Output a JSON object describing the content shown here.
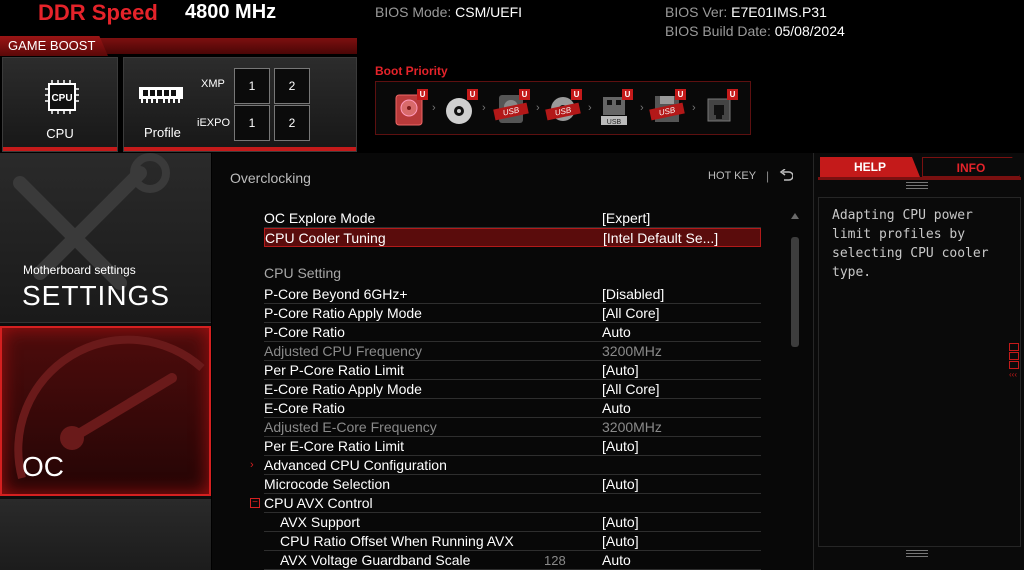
{
  "header": {
    "ddr_label": "DDR Speed",
    "ddr_value": "4800 MHz",
    "game_boost": "GAME BOOST",
    "cpu_tile_label": "CPU",
    "cpu_chip_text": "CPU",
    "profile_tile_label": "Profile",
    "xmp_label": "XMP",
    "iexpo_label": "iEXPO",
    "xmp_buttons": [
      "1",
      "2"
    ],
    "iexpo_buttons": [
      "1",
      "2"
    ],
    "bios_mode_label": "BIOS Mode: ",
    "bios_mode_value": "CSM/UEFI",
    "bios_ver_label": "BIOS Ver: ",
    "bios_ver_value": "E7E01IMS.P31",
    "bios_date_label": "BIOS Build Date: ",
    "bios_date_value": "05/08/2024",
    "boot_priority_label": "Boot Priority",
    "boot_devices": [
      {
        "icon": "hard-drive-icon",
        "badge": "U",
        "text": ""
      },
      {
        "icon": "optical-disc-icon",
        "badge": "U",
        "text": ""
      },
      {
        "icon": "usb-hdd-icon",
        "badge": "U",
        "text": "USB"
      },
      {
        "icon": "usb-cd-icon",
        "badge": "U",
        "text": "USB"
      },
      {
        "icon": "usb-key-icon",
        "badge": "U",
        "text": "USB"
      },
      {
        "icon": "usb-floppy-icon",
        "badge": "U",
        "text": "USB"
      },
      {
        "icon": "network-icon",
        "badge": "U",
        "text": ""
      }
    ]
  },
  "sidebar": {
    "settings_sub": "Motherboard settings",
    "settings_title": "SETTINGS",
    "oc_title": "OC"
  },
  "main": {
    "title": "Overclocking",
    "hotkey": "HOT KEY",
    "hotkey_sep": "|",
    "rows": [
      {
        "label": "OC Explore Mode",
        "value": "[Expert]"
      },
      {
        "label": "CPU Cooler Tuning",
        "value": "[Intel Default Se...]"
      },
      {
        "label": "CPU  Setting",
        "value": ""
      },
      {
        "label": "P-Core Beyond 6GHz+",
        "value": "[Disabled]"
      },
      {
        "label": "P-Core Ratio Apply Mode",
        "value": "[All Core]"
      },
      {
        "label": "P-Core Ratio",
        "value": "Auto"
      },
      {
        "label": "Adjusted CPU Frequency",
        "value": "3200MHz"
      },
      {
        "label": "Per P-Core Ratio Limit",
        "value": "[Auto]"
      },
      {
        "label": "E-Core Ratio Apply Mode",
        "value": "[All Core]"
      },
      {
        "label": "E-Core Ratio",
        "value": "Auto"
      },
      {
        "label": "Adjusted E-Core Frequency",
        "value": "3200MHz"
      },
      {
        "label": "Per E-Core Ratio Limit",
        "value": "[Auto]"
      },
      {
        "label": "Advanced CPU Configuration",
        "value": ""
      },
      {
        "label": "Microcode Selection",
        "value": "[Auto]"
      },
      {
        "label": "CPU AVX Control",
        "value": ""
      },
      {
        "label": "AVX Support",
        "value": "[Auto]"
      },
      {
        "label": "CPU Ratio Offset When Running AVX",
        "value": "[Auto]"
      },
      {
        "label": "AVX Voltage Guardband Scale",
        "value": "Auto",
        "mid": "128"
      }
    ]
  },
  "help": {
    "tab_help": "HELP",
    "tab_info": "INFO",
    "text": "Adapting CPU power limit profiles by selecting CPU cooler type."
  },
  "colors": {
    "accent": "#e5232a",
    "selected_bg": "#5a0c0c",
    "dim_text": "#8a8a8a"
  }
}
